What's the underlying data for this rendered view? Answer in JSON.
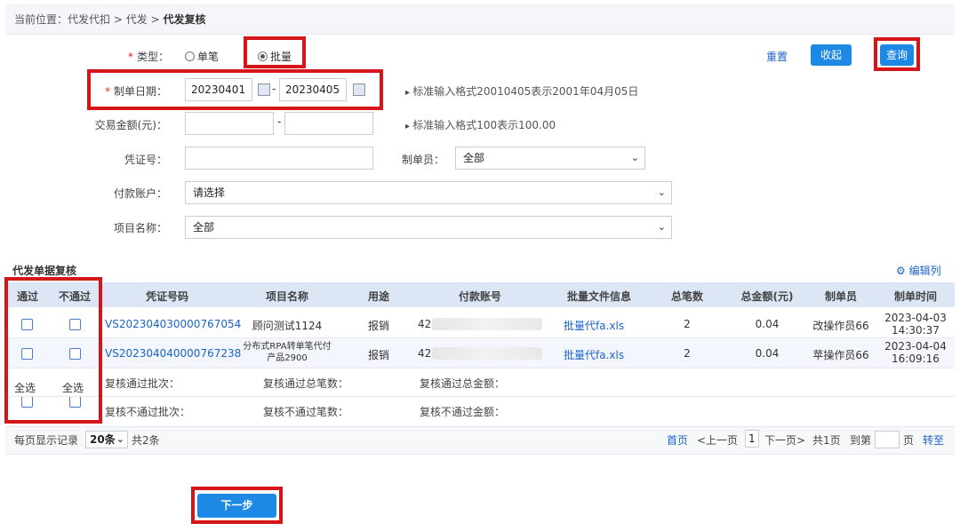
{
  "breadcrumb": {
    "prefix": "当前位置：",
    "path1": "代发代扣",
    "path2": "代发",
    "current": "代发复核",
    "sep": ">"
  },
  "form": {
    "type_label": "类型：",
    "type_single": "单笔",
    "type_batch": "批量",
    "date_label": "制单日期：",
    "date_from": "20230401",
    "date_to": "20230405",
    "dash": "-",
    "date_hint": "标准输入格式20010405表示2001年04月05日",
    "amount_label": "交易金额(元)：",
    "amount_hint": "标准输入格式100表示100.00",
    "voucher_label": "凭证号：",
    "maker_label": "制单员：",
    "maker_value": "全部",
    "account_label": "付款账户：",
    "account_value": "请选择",
    "project_label": "项目名称：",
    "project_value": "全部"
  },
  "buttons": {
    "reset": "重置",
    "collapse": "收起",
    "query": "查询",
    "next": "下一步"
  },
  "section": {
    "title": "代发单据复核",
    "edit_cols": "编辑列"
  },
  "table": {
    "headers": [
      "通过",
      "不通过",
      "凭证号码",
      "项目名称",
      "用途",
      "付款账号",
      "批量文件信息",
      "总笔数",
      "总金额(元)",
      "制单员",
      "制单时间"
    ],
    "rows": [
      {
        "voucher": "VS202304030000767054",
        "project": "顾问测试1124",
        "purpose": "报销",
        "account": "42",
        "file": "批量代fa.xls",
        "count": "2",
        "amount": "0.04",
        "maker": "改操作员66",
        "time1": "2023-04-03",
        "time2": "14:30:37"
      },
      {
        "voucher": "VS202304040000767238",
        "project1": "分布式RPA转单笔代付",
        "project2": "产品2900",
        "purpose": "报销",
        "account": "42",
        "file": "批量代fa.xls",
        "count": "2",
        "amount": "0.04",
        "maker": "苹操作员66",
        "time1": "2023-04-04",
        "time2": "16:09:16"
      }
    ],
    "select_all_pass": "全选",
    "select_all_fail": "全选",
    "summary_pass_batches": "复核通过批次：",
    "summary_pass_count": "复核通过总笔数：",
    "summary_pass_amount": "复核通过总金额：",
    "summary_fail_batches": "复核不通过批次：",
    "summary_fail_count": "复核不通过笔数：",
    "summary_fail_amount": "复核不通过金额："
  },
  "pagination": {
    "per_page_label": "每页显示记录",
    "per_page": "20条",
    "total": "共2条",
    "first": "首页",
    "prev": "<上一页",
    "page": "1",
    "next": "下一页>",
    "total_pages": "共1页",
    "goto_label": "到第",
    "page_unit": "页",
    "go": "转至"
  },
  "colors": {
    "accent": "#1e88e5",
    "highlight": "#d6151b",
    "link": "#1a63c9",
    "header_bg": "#dce6f4"
  },
  "icons": {
    "calendar": "calendar-icon",
    "gear": "gear-icon",
    "chevron": "chevron-down-icon"
  }
}
